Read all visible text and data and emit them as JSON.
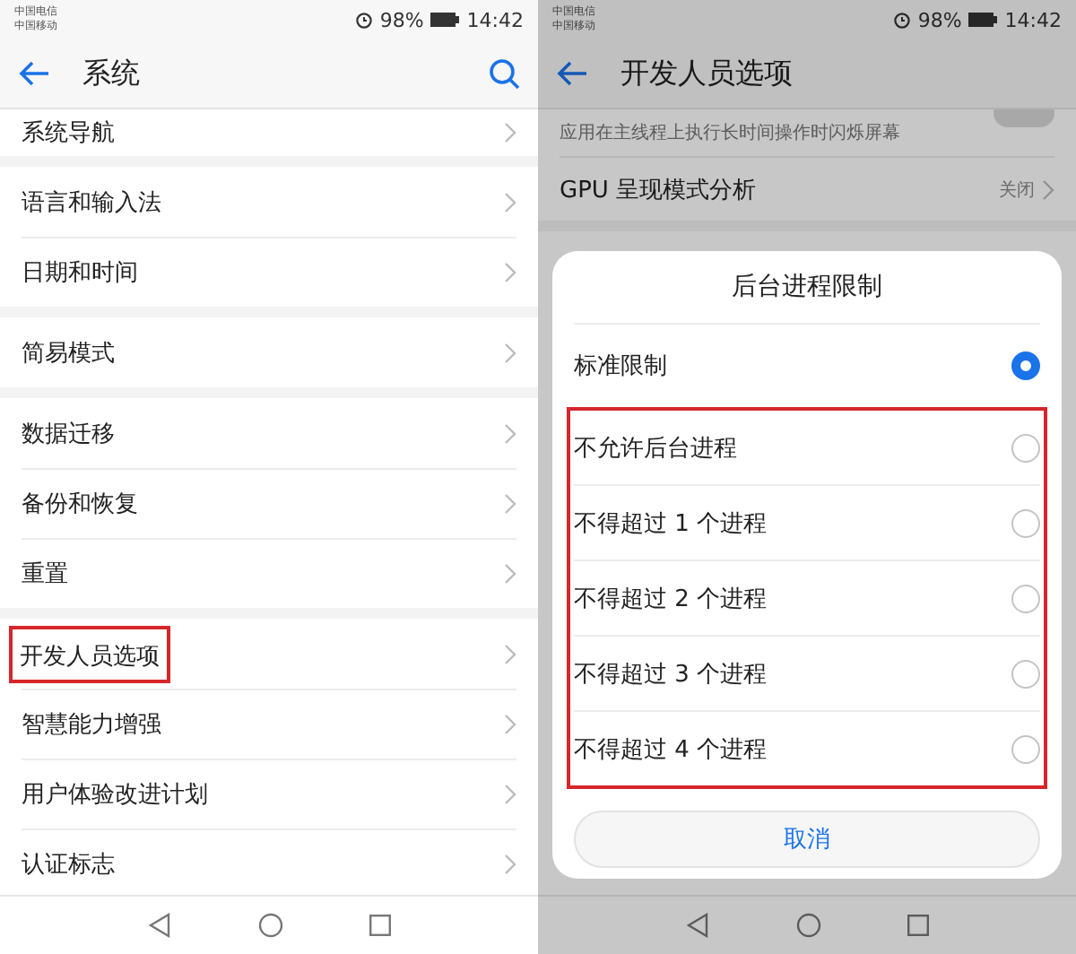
{
  "left_screen": {
    "status_bar": {
      "carriers": [
        "中国电信",
        "中国移动"
      ],
      "battery": "98%",
      "time": "14:42"
    },
    "title": "系统",
    "groups": [
      [
        {
          "label": "系统导航",
          "highlighted": false
        }
      ],
      [
        {
          "label": "语言和输入法",
          "highlighted": false
        },
        {
          "label": "日期和时间",
          "highlighted": false
        }
      ],
      [
        {
          "label": "简易模式",
          "highlighted": false
        }
      ],
      [
        {
          "label": "数据迁移",
          "highlighted": false
        },
        {
          "label": "备份和恢复",
          "highlighted": false
        },
        {
          "label": "重置",
          "highlighted": false
        }
      ],
      [
        {
          "label": "开发人员选项",
          "highlighted": true
        },
        {
          "label": "智慧能力增强",
          "highlighted": false
        },
        {
          "label": "用户体验改进计划",
          "highlighted": false
        },
        {
          "label": "认证标志",
          "highlighted": false
        }
      ]
    ]
  },
  "right_screen": {
    "status_bar": {
      "carriers": [
        "中国电信",
        "中国移动"
      ],
      "battery": "98%",
      "time": "14:42"
    },
    "title": "开发人员选项",
    "settings": [
      {
        "kind": "toggle",
        "description": "应用在主线程上执行长时间操作时闪烁屏幕",
        "on": false
      },
      {
        "kind": "value",
        "label": "GPU 呈现模式分析",
        "value": "关闭"
      }
    ],
    "dialog": {
      "title": "后台进程限制",
      "options": [
        {
          "label": "标准限制",
          "selected": true,
          "highlighted": false
        },
        {
          "label": "不允许后台进程",
          "selected": false,
          "highlighted": true
        },
        {
          "label": "不得超过 1 个进程",
          "selected": false,
          "highlighted": true
        },
        {
          "label": "不得超过 2 个进程",
          "selected": false,
          "highlighted": true
        },
        {
          "label": "不得超过 3 个进程",
          "selected": false,
          "highlighted": true
        },
        {
          "label": "不得超过 4 个进程",
          "selected": false,
          "highlighted": true
        }
      ],
      "cancel": "取消"
    }
  }
}
